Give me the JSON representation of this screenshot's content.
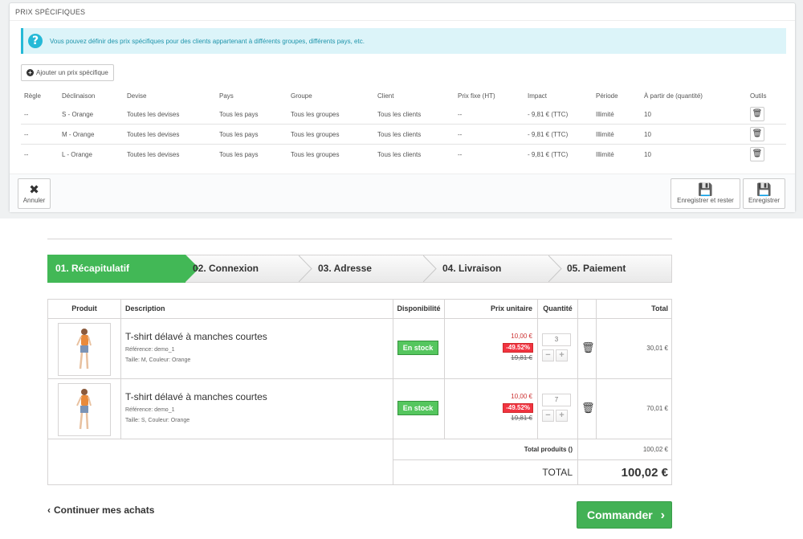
{
  "admin": {
    "panel_title": "PRIX SPÉCIFIQUES",
    "info_text": "Vous pouvez définir des prix spécifiques pour des clients appartenant à différents groupes, différents pays, etc.",
    "add_button": "Ajouter un prix spécifique",
    "columns": [
      "Règle",
      "Déclinaison",
      "Devise",
      "Pays",
      "Groupe",
      "Client",
      "Prix fixe (HT)",
      "Impact",
      "Période",
      "À partir de (quantité)",
      "Outils"
    ],
    "rows": [
      {
        "rule": "--",
        "combination": "S - Orange",
        "currency": "Toutes les devises",
        "country": "Tous les pays",
        "group": "Tous les groupes",
        "customer": "Tous les clients",
        "fixed_price": "--",
        "impact": "- 9,81 € (TTC)",
        "period": "Illimité",
        "from_qty": "10"
      },
      {
        "rule": "--",
        "combination": "M - Orange",
        "currency": "Toutes les devises",
        "country": "Tous les pays",
        "group": "Tous les groupes",
        "customer": "Tous les clients",
        "fixed_price": "--",
        "impact": "- 9,81 € (TTC)",
        "period": "Illimité",
        "from_qty": "10"
      },
      {
        "rule": "--",
        "combination": "L - Orange",
        "currency": "Toutes les devises",
        "country": "Tous les pays",
        "group": "Tous les groupes",
        "customer": "Tous les clients",
        "fixed_price": "--",
        "impact": "- 9,81 € (TTC)",
        "period": "Illimité",
        "from_qty": "10"
      }
    ],
    "cancel_label": "Annuler",
    "save_stay_label": "Enregistrer et rester",
    "save_label": "Enregistrer",
    "info_color": "#25b9d7"
  },
  "shop": {
    "steps": [
      "01. Récapitulatif",
      "02. Connexion",
      "03. Adresse",
      "04. Livraison",
      "05. Paiement"
    ],
    "active_step": 0,
    "accent_color": "#42b856",
    "columns": {
      "product": "Produit",
      "description": "Description",
      "availability": "Disponibilité",
      "unit_price": "Prix unitaire",
      "quantity": "Quantité",
      "total": "Total"
    },
    "items": [
      {
        "name": "T-shirt délavé à manches courtes",
        "reference": "Référence: demo_1",
        "attributes": "Taille: M, Couleur: Orange",
        "stock": "En stock",
        "price": "10,00 €",
        "discount": "-49.52%",
        "old_price": "19,81 €",
        "quantity": "3",
        "total": "30,01 €"
      },
      {
        "name": "T-shirt délavé à manches courtes",
        "reference": "Référence: demo_1",
        "attributes": "Taille: S, Couleur: Orange",
        "stock": "En stock",
        "price": "10,00 €",
        "discount": "-49.52%",
        "old_price": "19,81 €",
        "quantity": "7",
        "total": "70,01 €"
      }
    ],
    "total_products_label": "Total produits ()",
    "total_products_value": "100,02 €",
    "total_label": "TOTAL",
    "total_value": "100,02 €",
    "continue_label": "Continuer mes achats",
    "order_label": "Commander"
  }
}
